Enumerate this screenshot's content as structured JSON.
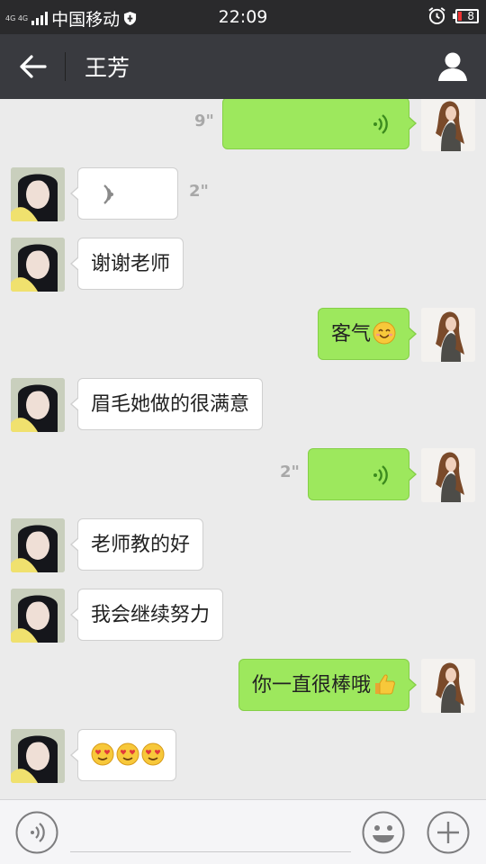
{
  "status_bar": {
    "network_small": "4G 4G",
    "carrier": "中国移动",
    "time": "22:09",
    "battery": "8"
  },
  "header": {
    "title": "王芳"
  },
  "messages": [
    {
      "side": "out",
      "type": "voice",
      "duration": "9\""
    },
    {
      "side": "in",
      "type": "voice",
      "duration": "2\""
    },
    {
      "side": "in",
      "type": "text",
      "text": "谢谢老师"
    },
    {
      "side": "out",
      "type": "text",
      "text": "客气",
      "emoji": "smile-emoji"
    },
    {
      "side": "in",
      "type": "text",
      "text": "眉毛她做的很满意"
    },
    {
      "side": "out",
      "type": "voice",
      "duration": "2\""
    },
    {
      "side": "in",
      "type": "text",
      "text": "老师教的好"
    },
    {
      "side": "in",
      "type": "text",
      "text": "我会继续努力"
    },
    {
      "side": "out",
      "type": "text",
      "text": "你一直很棒哦",
      "emoji": "thumbs-up-emoji"
    },
    {
      "side": "in",
      "type": "emoji",
      "emoji": [
        "heart-eyes-emoji",
        "heart-eyes-emoji",
        "heart-eyes-emoji"
      ]
    }
  ],
  "input_bar": {
    "text_value": "",
    "icons": [
      "voice-icon",
      "emoji-icon",
      "plus-icon"
    ]
  },
  "colors": {
    "title_bar": "#393a3f",
    "status_bar": "#2a2a2c",
    "chat_bg": "#ebebeb",
    "outgoing_bubble": "#9de85d",
    "incoming_bubble": "#ffffff"
  }
}
